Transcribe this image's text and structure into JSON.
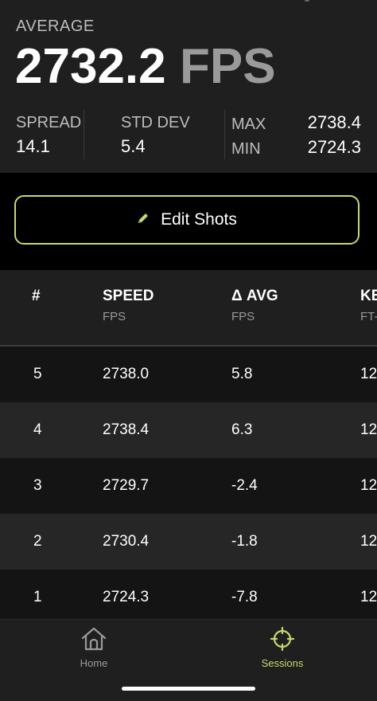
{
  "summary": {
    "average_label": "AVERAGE",
    "average_value": "2732.2",
    "average_unit": "FPS",
    "spread_label": "SPREAD",
    "spread_value": "14.1",
    "stddev_label": "STD DEV",
    "stddev_value": "5.4",
    "max_label": "MAX",
    "max_value": "2738.4",
    "min_label": "MIN",
    "min_value": "2724.3"
  },
  "edit_button": {
    "label": "Edit Shots",
    "icon": "pencil-icon"
  },
  "table": {
    "columns": [
      {
        "header": "#",
        "unit": ""
      },
      {
        "header": "SPEED",
        "unit": "FPS"
      },
      {
        "header": "Δ AVG",
        "unit": "FPS"
      },
      {
        "header": "KE",
        "unit": "FT-"
      }
    ],
    "rows": [
      {
        "num": "5",
        "speed": "2738.0",
        "delta": "5.8",
        "ke": "12"
      },
      {
        "num": "4",
        "speed": "2738.4",
        "delta": "6.3",
        "ke": "12"
      },
      {
        "num": "3",
        "speed": "2729.7",
        "delta": "-2.4",
        "ke": "12"
      },
      {
        "num": "2",
        "speed": "2730.4",
        "delta": "-1.8",
        "ke": "12"
      },
      {
        "num": "1",
        "speed": "2724.3",
        "delta": "-7.8",
        "ke": "12"
      }
    ]
  },
  "tabbar": {
    "tabs": [
      {
        "label": "Home",
        "icon": "home-icon",
        "active": false
      },
      {
        "label": "Sessions",
        "icon": "crosshair-icon",
        "active": true
      }
    ],
    "active_color": "#c5da6a",
    "inactive_color": "#9a9a9a"
  },
  "colors": {
    "accent": "#c5da6a"
  }
}
